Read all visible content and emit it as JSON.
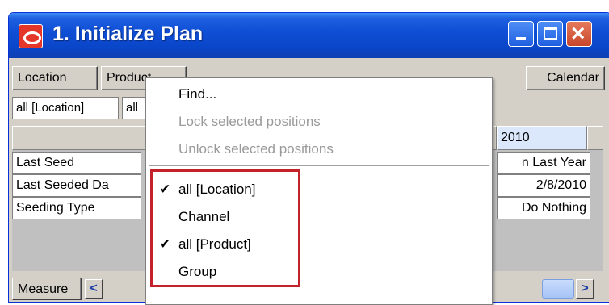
{
  "window": {
    "title": "1. Initialize Plan"
  },
  "toolbar": {
    "location_label": "Location",
    "product_label": "Product",
    "calendar_label": "Calendar"
  },
  "filters": {
    "location_chip": "all [Location]",
    "product_chip": "all"
  },
  "grid": {
    "column_header": "2010",
    "rows": [
      {
        "label": "Last Seed",
        "value": "n Last Year"
      },
      {
        "label": "Last Seeded Da",
        "value": "2/8/2010"
      },
      {
        "label": "Seeding Type",
        "value": "Do Nothing"
      }
    ]
  },
  "footer": {
    "measure_label": "Measure"
  },
  "context_menu": {
    "find": "Find...",
    "lock": "Lock selected positions",
    "unlock": "Unlock selected positions",
    "items": [
      {
        "label": "all [Location]",
        "checked": true
      },
      {
        "label": "Channel",
        "checked": false
      },
      {
        "label": "all [Product]",
        "checked": true
      },
      {
        "label": "Group",
        "checked": false
      }
    ],
    "check_glyph": "✔"
  },
  "colors": {
    "highlight": "#c4222a",
    "title_bar": "#0a46c9"
  }
}
